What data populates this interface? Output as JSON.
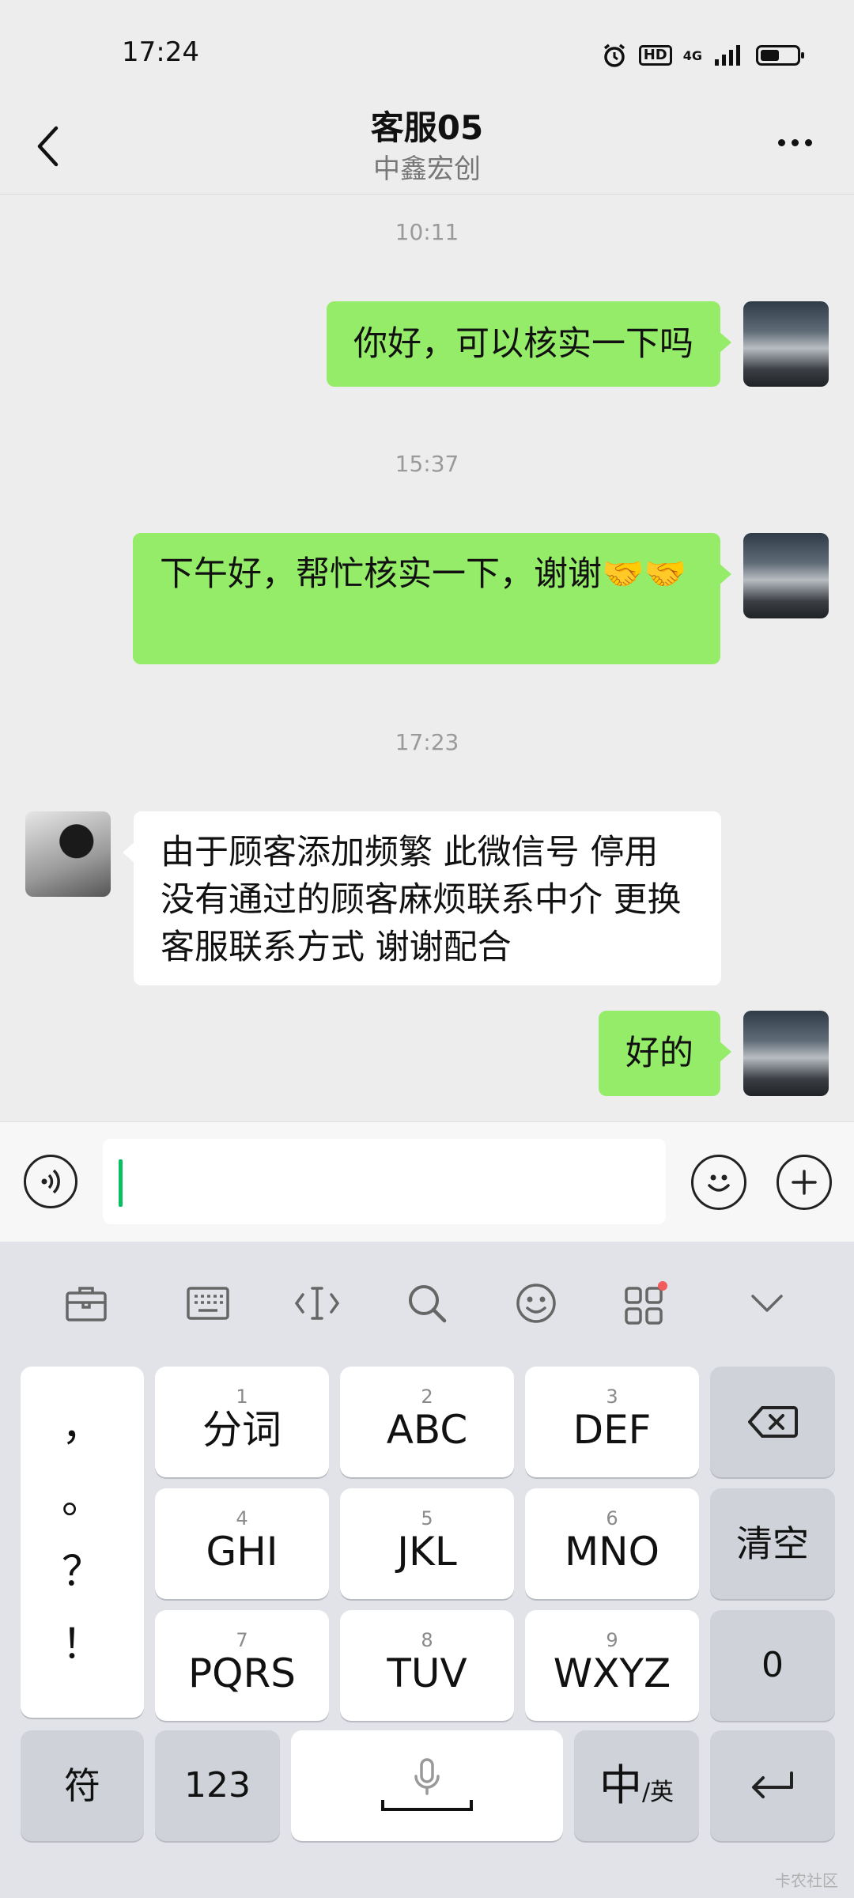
{
  "status_bar": {
    "time": "17:24",
    "hd": "HD",
    "network": "4G"
  },
  "header": {
    "title": "客服05",
    "subtitle": "中鑫宏创"
  },
  "messages": [
    {
      "timestamp": "10:11",
      "from": "me",
      "text": "你好，可以核实一下吗"
    },
    {
      "timestamp": "15:37",
      "from": "me",
      "text": "下午好，帮忙核实一下，谢谢🤝🤝"
    },
    {
      "timestamp": "17:23",
      "from": "other",
      "text": "由于顾客添加频繁 此微信号 停用 没有通过的顾客麻烦联系中介 更换客服联系方式 谢谢配合"
    },
    {
      "from": "me",
      "text": "好的"
    }
  ],
  "input": {
    "value": ""
  },
  "keyboard": {
    "punctuation": [
      "，",
      "。",
      "？",
      "！"
    ],
    "keys": [
      {
        "num": "1",
        "label": "分词"
      },
      {
        "num": "2",
        "label": "ABC"
      },
      {
        "num": "3",
        "label": "DEF"
      },
      {
        "num": "4",
        "label": "GHI"
      },
      {
        "num": "5",
        "label": "JKL"
      },
      {
        "num": "6",
        "label": "MNO"
      },
      {
        "num": "7",
        "label": "PQRS"
      },
      {
        "num": "8",
        "label": "TUV"
      },
      {
        "num": "9",
        "label": "WXYZ"
      }
    ],
    "clear_label": "清空",
    "zero_label": "0",
    "symbol_label": "符",
    "numbers_label": "123",
    "lang_main": "中",
    "lang_alt": "/英"
  },
  "watermark": "卡农社区",
  "colors": {
    "bubble_me": "#95ec69",
    "accent": "#07c160",
    "notify_dot": "#f25c5c"
  }
}
